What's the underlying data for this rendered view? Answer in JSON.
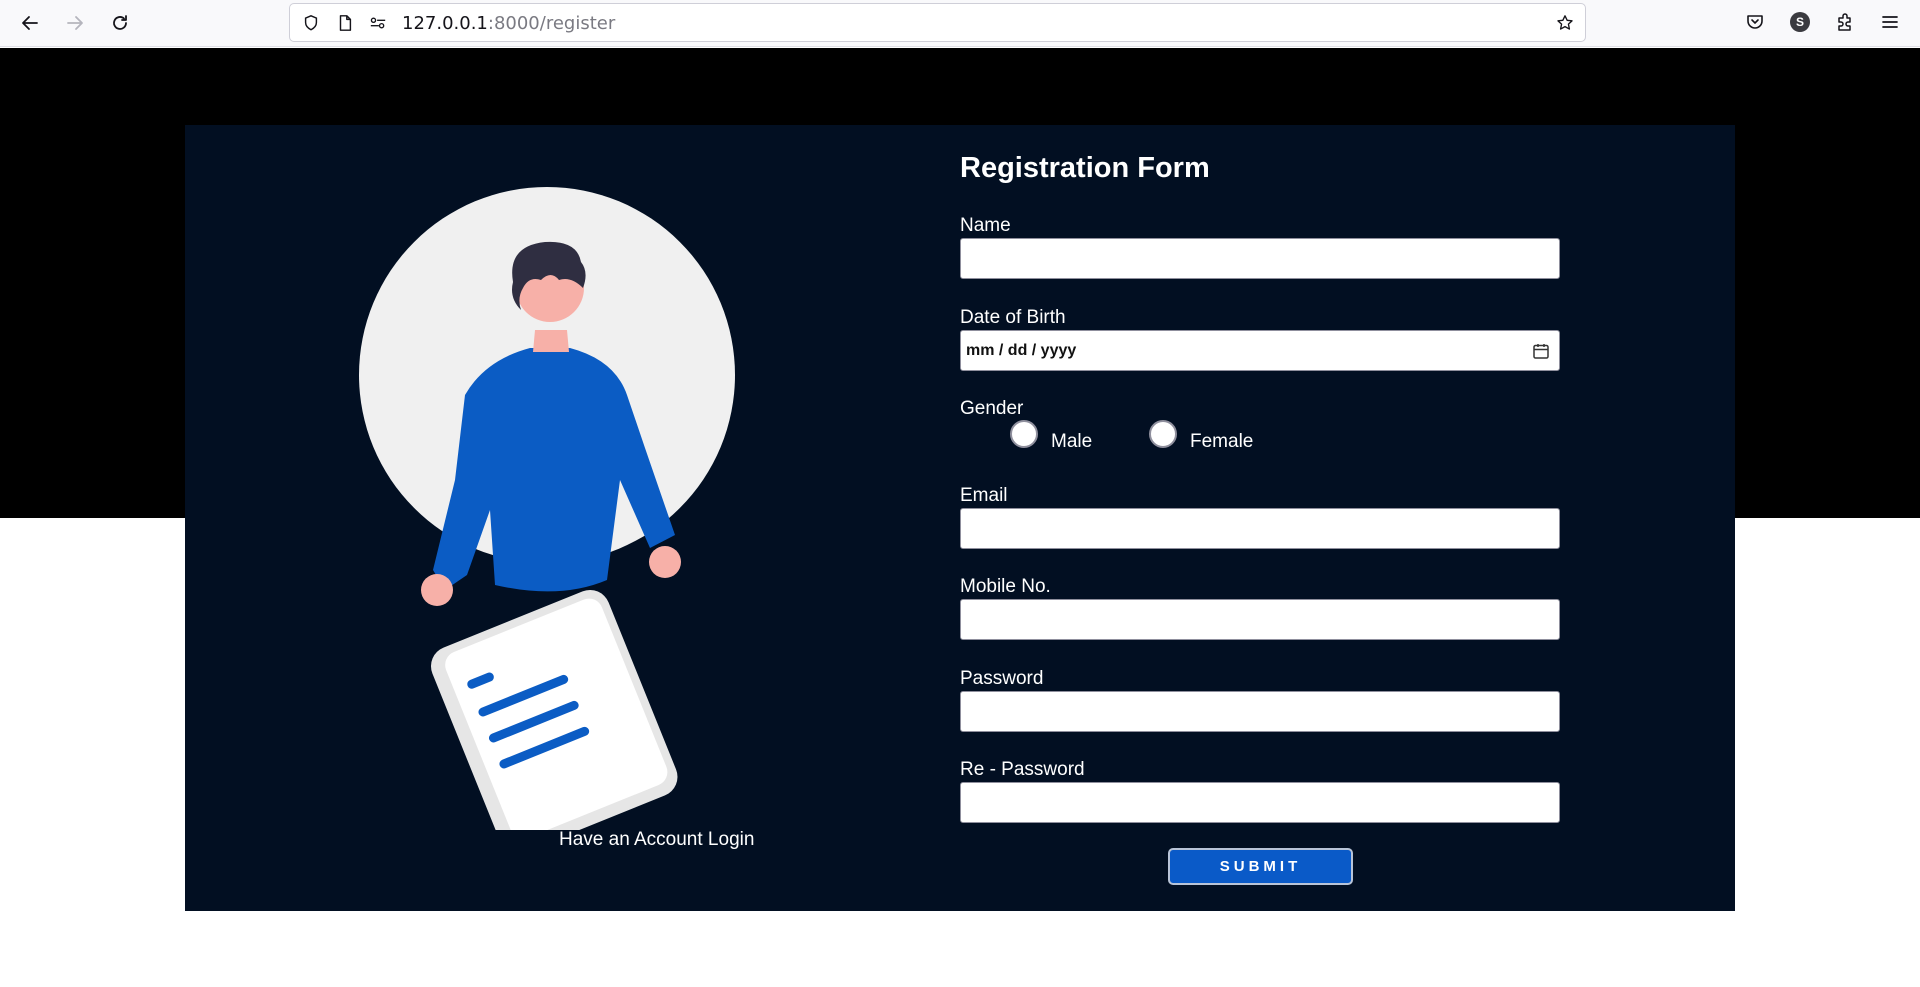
{
  "browser": {
    "url_host": "127.0.0.1",
    "url_rest": ":8000/register",
    "profile_initial": "S"
  },
  "colors": {
    "page_top": "#000000",
    "card_bg": "#020f22",
    "accent": "#0a5ac8"
  },
  "illustration": {
    "login_link": "Have an Account Login"
  },
  "form": {
    "title": "Registration Form",
    "name_label": "Name",
    "dob_label": "Date of Birth",
    "dob_placeholder": "mm / dd / yyyy",
    "gender_label": "Gender",
    "gender_male": "Male",
    "gender_female": "Female",
    "email_label": "Email",
    "mobile_label": "Mobile No.",
    "password_label": "Password",
    "repassword_label": "Re - Password",
    "submit_label": "SUBMIT"
  }
}
